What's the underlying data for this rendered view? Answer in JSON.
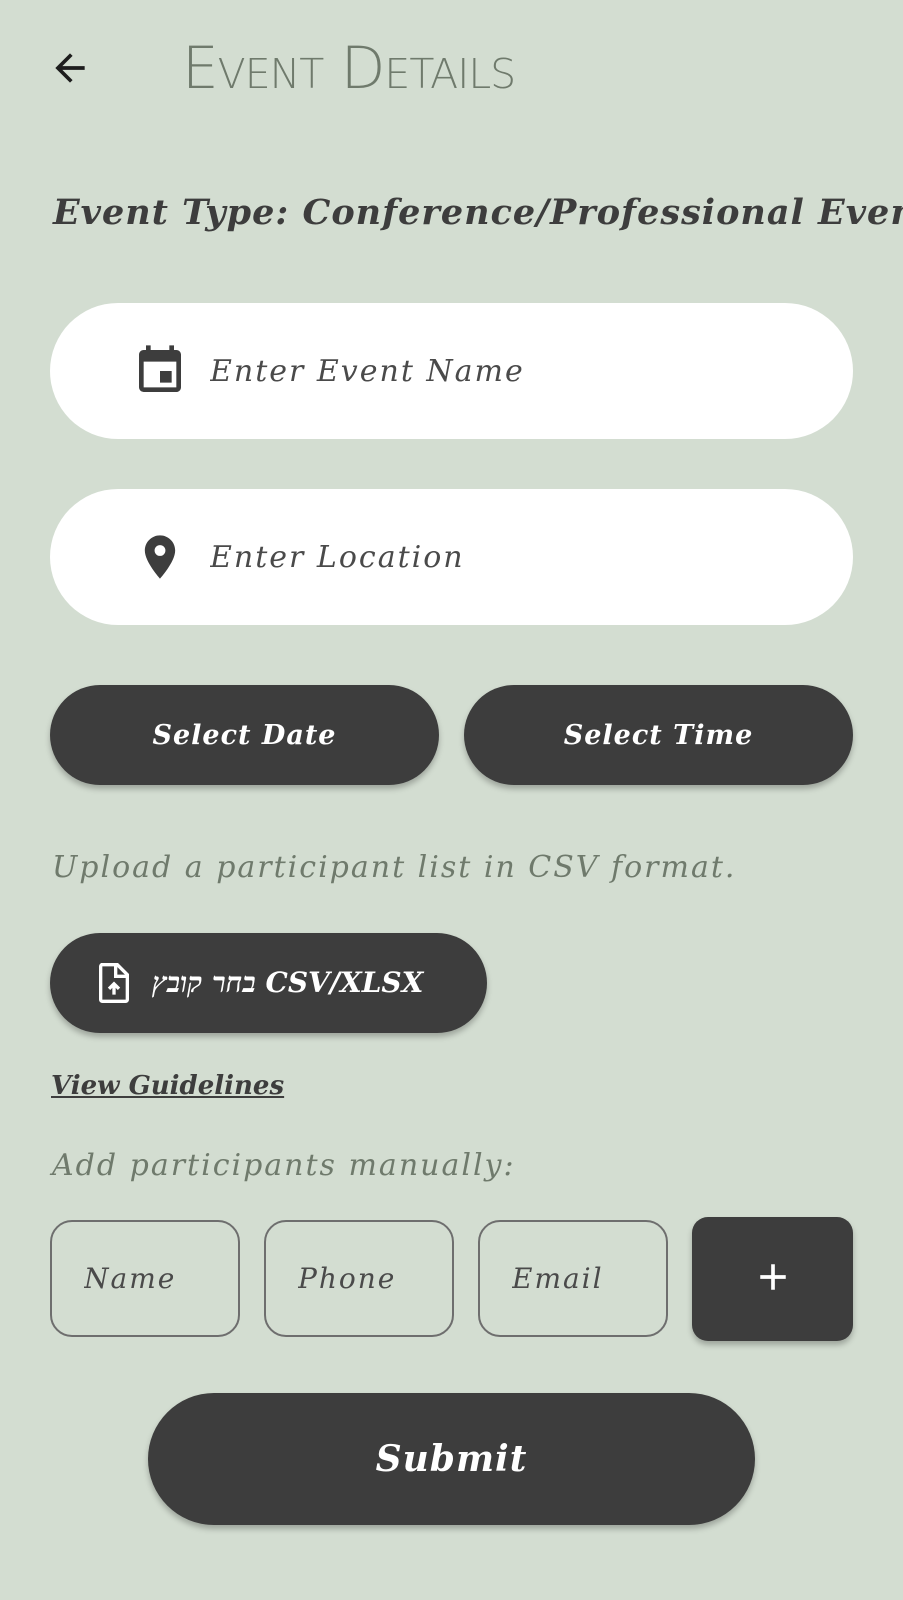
{
  "header": {
    "back_icon": "arrow-left-icon",
    "title": "Event Details"
  },
  "event_type": "Event Type: Conference/Professional Event",
  "form": {
    "event_name": {
      "icon": "calendar-icon",
      "placeholder": "Enter Event Name",
      "value": ""
    },
    "location": {
      "icon": "location-pin-icon",
      "placeholder": "Enter Location",
      "value": ""
    },
    "select_date_label": "Select Date",
    "select_time_label": "Select Time"
  },
  "upload": {
    "hint": "Upload a participant list in CSV format.",
    "button_icon": "file-upload-icon",
    "button_label": "בחר קובץ CSV/XLSX",
    "guidelines_link": "View Guidelines"
  },
  "manual": {
    "hint": "Add participants manually:",
    "name_placeholder": "Name",
    "phone_placeholder": "Phone",
    "email_placeholder": "Email",
    "add_label": "+"
  },
  "submit_label": "Submit",
  "colors": {
    "background": "#d3ddd1",
    "dark": "#3d3d3d",
    "muted_text": "#6f7a6c",
    "input_bg": "#ffffff"
  }
}
